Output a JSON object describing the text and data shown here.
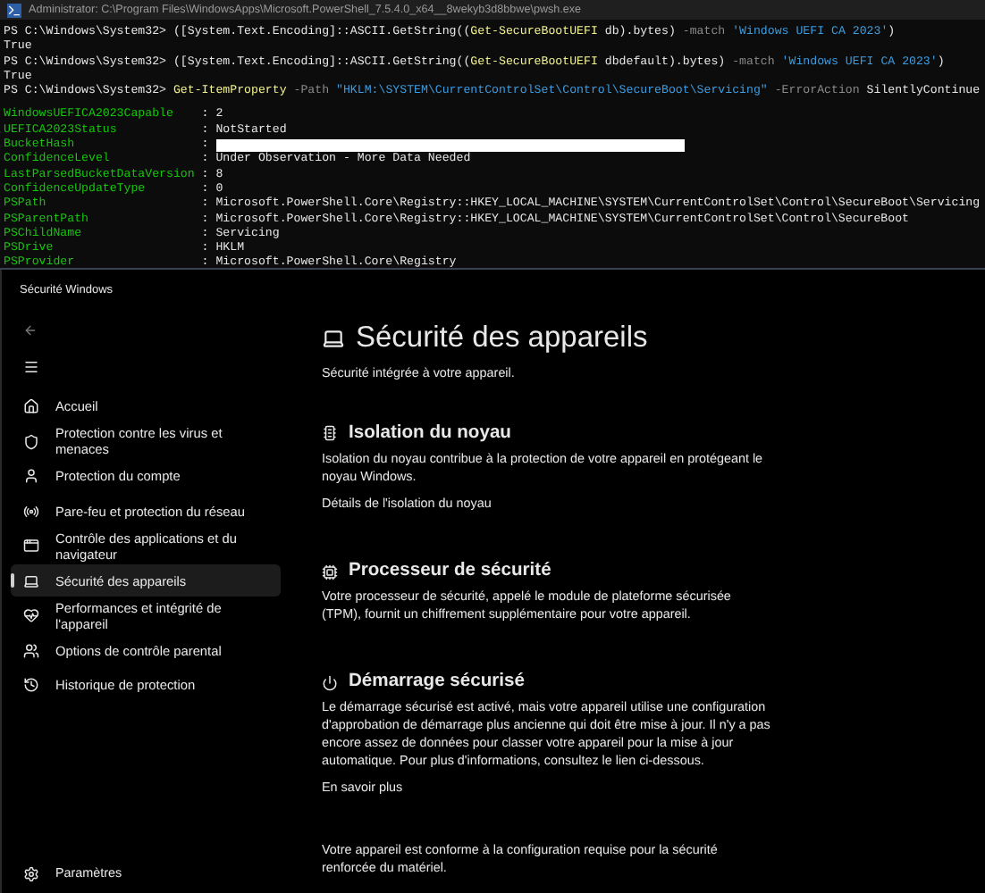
{
  "terminal": {
    "title": "Administrator: C:\\Program Files\\WindowsApps\\Microsoft.PowerShell_7.5.4.0_x64__8wekyb3d8bbwe\\pwsh.exe",
    "lines": [
      {
        "kind": "command",
        "segments": [
          {
            "kind": "prompt",
            "text": "PS C:\\Windows\\System32> "
          },
          {
            "kind": "plain",
            "text": "([System.Text.Encoding]::ASCII.GetString(("
          },
          {
            "kind": "cmdlet",
            "text": "Get-SecureBootUEFI"
          },
          {
            "kind": "plain",
            "text": " db).bytes) "
          },
          {
            "kind": "param",
            "text": "-match "
          },
          {
            "kind": "string",
            "text": "'Windows UEFI CA 2023'"
          },
          {
            "kind": "plain",
            "text": ")"
          }
        ]
      },
      {
        "kind": "output",
        "text": "True"
      },
      {
        "kind": "command",
        "segments": [
          {
            "kind": "prompt",
            "text": "PS C:\\Windows\\System32> "
          },
          {
            "kind": "plain",
            "text": "([System.Text.Encoding]::ASCII.GetString(("
          },
          {
            "kind": "cmdlet",
            "text": "Get-SecureBootUEFI"
          },
          {
            "kind": "plain",
            "text": " dbdefault).bytes) "
          },
          {
            "kind": "param",
            "text": "-match "
          },
          {
            "kind": "string",
            "text": "'Windows UEFI CA 2023'"
          },
          {
            "kind": "plain",
            "text": ")"
          }
        ]
      },
      {
        "kind": "output",
        "text": "True"
      },
      {
        "kind": "command",
        "segments": [
          {
            "kind": "prompt",
            "text": "PS C:\\Windows\\System32> "
          },
          {
            "kind": "cmdlet",
            "text": "Get-ItemProperty "
          },
          {
            "kind": "param",
            "text": "-Path "
          },
          {
            "kind": "string",
            "text": "\"HKLM:\\SYSTEM\\CurrentControlSet\\Control\\SecureBoot\\Servicing\" "
          },
          {
            "kind": "param",
            "text": "-ErrorAction "
          },
          {
            "kind": "plain",
            "text": "SilentlyContinue"
          }
        ]
      },
      {
        "kind": "blank"
      }
    ],
    "properties": [
      {
        "name": "WindowsUEFICA2023Capable",
        "kind": "text",
        "value": "2"
      },
      {
        "name": "UEFICA2023Status",
        "kind": "text",
        "value": "NotStarted"
      },
      {
        "name": "BucketHash",
        "kind": "redacted"
      },
      {
        "name": "ConfidenceLevel",
        "kind": "text",
        "value": "Under Observation - More Data Needed"
      },
      {
        "name": "LastParsedBucketDataVersion",
        "kind": "text",
        "value": "8"
      },
      {
        "name": "ConfidenceUpdateType",
        "kind": "text",
        "value": "0"
      },
      {
        "name": "PSPath",
        "kind": "text",
        "value": "Microsoft.PowerShell.Core\\Registry::HKEY_LOCAL_MACHINE\\SYSTEM\\CurrentControlSet\\Control\\SecureBoot\\Servicing"
      },
      {
        "name": "PSParentPath",
        "kind": "text",
        "value": "Microsoft.PowerShell.Core\\Registry::HKEY_LOCAL_MACHINE\\SYSTEM\\CurrentControlSet\\Control\\SecureBoot"
      },
      {
        "name": "PSChildName",
        "kind": "text",
        "value": "Servicing"
      },
      {
        "name": "PSDrive",
        "kind": "text",
        "value": "HKLM"
      },
      {
        "name": "PSProvider",
        "kind": "text",
        "value": "Microsoft.PowerShell.Core\\Registry"
      }
    ],
    "separator": ":"
  },
  "security": {
    "title": "Sécurité Windows",
    "nav": [
      {
        "kind": "home",
        "label": "Accueil",
        "selected": false
      },
      {
        "kind": "shield",
        "label": "Protection contre les virus et menaces",
        "selected": false
      },
      {
        "kind": "person",
        "label": "Protection du compte",
        "selected": false
      },
      {
        "kind": "antenna",
        "label": "Pare-feu et protection du réseau",
        "selected": false
      },
      {
        "kind": "window",
        "label": "Contrôle des applications et du navigateur",
        "selected": false
      },
      {
        "kind": "laptop",
        "label": "Sécurité des appareils",
        "selected": true
      },
      {
        "kind": "heart",
        "label": "Performances et intégrité de l'appareil",
        "selected": false
      },
      {
        "kind": "family",
        "label": "Options de contrôle parental",
        "selected": false
      },
      {
        "kind": "history",
        "label": "Historique de protection",
        "selected": false
      }
    ],
    "settings": "Paramètres",
    "page": {
      "title": "Sécurité des appareils",
      "subtitle": "Sécurité intégrée à votre appareil.",
      "sections": [
        {
          "kind": "chip",
          "heading": "Isolation du noyau",
          "text": "Isolation du noyau contribue à la protection de votre appareil en protégeant le noyau Windows.",
          "link": "Détails de l'isolation du noyau"
        },
        {
          "kind": "processor",
          "heading": "Processeur de sécurité",
          "text": "Votre processeur de sécurité, appelé le module de plateforme sécurisée (TPM), fournit un chiffrement supplémentaire pour votre appareil."
        },
        {
          "kind": "power",
          "heading": "Démarrage sécurisé",
          "text": "Le démarrage sécurisé est activé, mais votre appareil utilise une configuration d'approbation de démarrage plus ancienne qui doit être mise à jour. Il n'y a pas encore assez de données pour classer votre appareil pour la mise à jour automatique. Pour plus d'informations, consultez le lien ci-dessous.",
          "link": "En savoir plus"
        }
      ],
      "footer": "Votre appareil est conforme à la configuration requise pour la sécurité renforcée du matériel."
    }
  }
}
